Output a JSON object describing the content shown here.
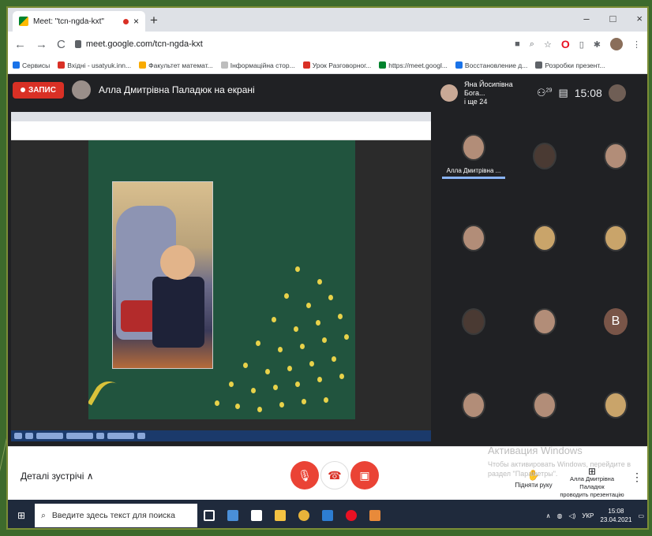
{
  "browser": {
    "tab_title": "Meet: \"tcn-ngda-kxt\"",
    "url": "meet.google.com/tcn-ngda-kxt",
    "window_controls": [
      "–",
      "□",
      "×"
    ]
  },
  "bookmarks": [
    {
      "label": "Сервисы",
      "color": "#1a73e8"
    },
    {
      "label": "Вхідні - usatyuk.inn...",
      "color": "#d93025"
    },
    {
      "label": "Факультет математ...",
      "color": "#f9ab00"
    },
    {
      "label": "Інформаційна стор...",
      "color": "#bdbdbd"
    },
    {
      "label": "Урок Разговорног...",
      "color": "#d93025"
    },
    {
      "label": "https://meet.googl...",
      "color": "#00832d"
    },
    {
      "label": "Восстановление д...",
      "color": "#1a73e8"
    },
    {
      "label": "Розробки презент...",
      "color": "#5f6368"
    }
  ],
  "meet": {
    "record_label": "ЗАПИС",
    "presenter_title": "Алла Дмитрівна Паладюк на екрані",
    "pinned_user": "Яна Йосипівна Бога...",
    "pinned_user_sub": "і ще 24",
    "participants_count": "29",
    "clock": "15:08",
    "participant_tile_name": "Алла Дмитрівна ...",
    "letter_avatar": "B"
  },
  "controls": {
    "details_label": "Деталі зустрічі",
    "raise_hand": "Підняти руку",
    "presenting_line1": "Алла Дмитрівна Паладюк",
    "presenting_line2": "проводить презентацію"
  },
  "watermark": {
    "title": "Активация Windows",
    "line1": "Чтобы активировать Windows, перейдите в",
    "line2": "раздел \"Параметры\"."
  },
  "taskbar": {
    "search_placeholder": "Введите здесь текст для поиска",
    "lang": "УКР",
    "time": "15:08",
    "date": "23.04.2021"
  },
  "colors": {
    "record": "#d93025",
    "slide_bg": "#21543e",
    "dots": "#e8d24a",
    "meet_bg": "#202124"
  }
}
